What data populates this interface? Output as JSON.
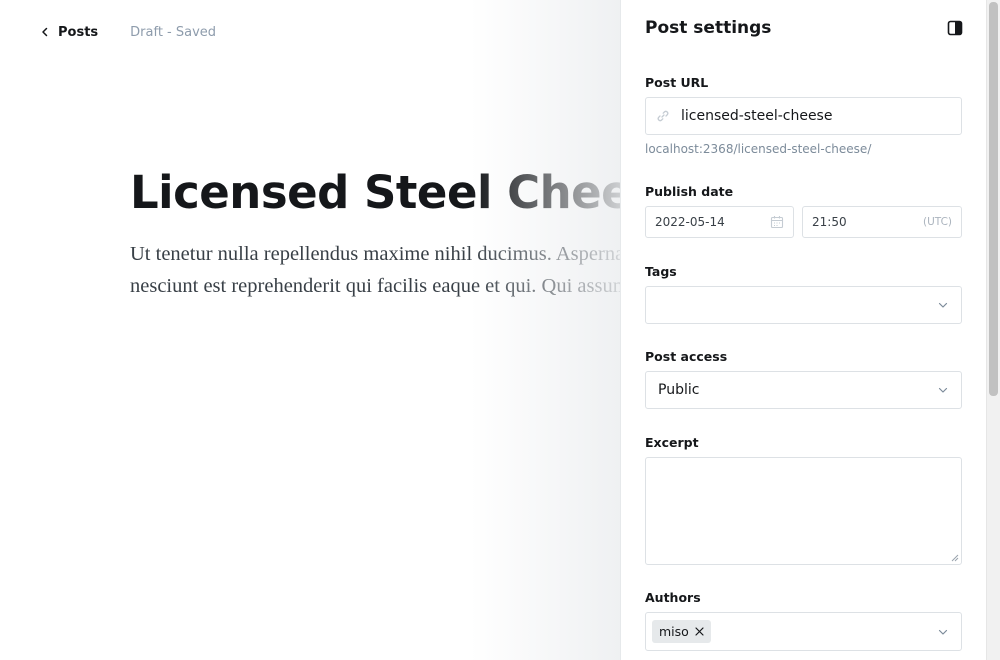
{
  "editor": {
    "back_label": "Posts",
    "status": "Draft - Saved",
    "title": "Licensed Steel Cheese",
    "body": "Ut tenetur nulla repellendus maxime nihil ducimus. Aspernatur molestiae nesciunt est reprehenderit qui facilis eaque et qui. Qui assumenda tempore."
  },
  "settings": {
    "title": "Post settings",
    "url_label": "Post URL",
    "url_value": "licensed-steel-cheese",
    "url_hint": "localhost:2368/licensed-steel-cheese/",
    "publish_label": "Publish date",
    "date_value": "2022-05-14",
    "time_value": "21:50",
    "timezone": "(UTC)",
    "tags_label": "Tags",
    "tags_value": "",
    "access_label": "Post access",
    "access_value": "Public",
    "excerpt_label": "Excerpt",
    "excerpt_value": "",
    "authors_label": "Authors",
    "authors": [
      "miso"
    ]
  },
  "icons": [
    "chevron-left-icon",
    "sidebar-toggle-icon",
    "link-icon",
    "calendar-icon",
    "chevron-down-icon",
    "remove-icon"
  ],
  "colors": {
    "text": "#15171a",
    "muted": "#8e9cac",
    "border": "#dde1e5",
    "token": "#e6e9eb"
  }
}
